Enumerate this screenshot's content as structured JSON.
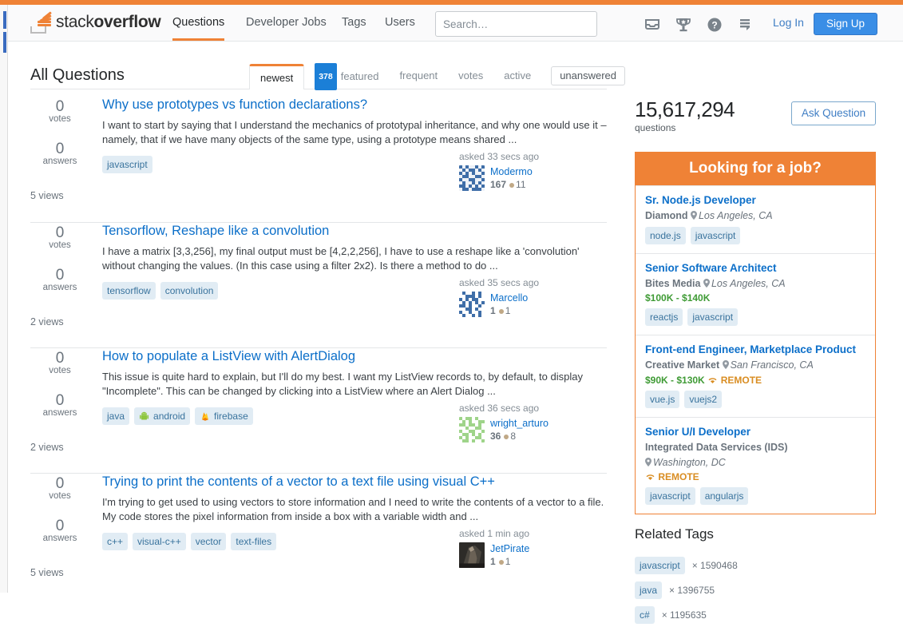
{
  "header": {
    "logo_text_light": "stack",
    "logo_text_bold": "overflow",
    "nav": [
      {
        "label": "Questions",
        "name": "nav-questions",
        "active": true
      },
      {
        "label": "Developer Jobs",
        "name": "nav-devjobs",
        "active": false
      },
      {
        "label": "Tags",
        "name": "nav-tags",
        "active": false
      },
      {
        "label": "Users",
        "name": "nav-users",
        "active": false
      }
    ],
    "search_placeholder": "Search…",
    "search_value": "",
    "icons": [
      "inbox-icon",
      "trophy-icon",
      "help-icon",
      "review-icon"
    ],
    "login_label": "Log In",
    "signup_label": "Sign Up"
  },
  "main": {
    "page_title": "All Questions",
    "tabs": [
      {
        "label": "newest",
        "active": true
      },
      {
        "label": "featured",
        "badge": "378",
        "active": false
      },
      {
        "label": "frequent",
        "active": false
      },
      {
        "label": "votes",
        "active": false
      },
      {
        "label": "active",
        "active": false
      }
    ],
    "unanswered_label": "unanswered",
    "question_count": "15,617,294",
    "question_count_label": "questions",
    "ask_button": "Ask Question"
  },
  "questions": [
    {
      "votes": "0",
      "votes_label": "votes",
      "answers": "0",
      "answers_label": "answers",
      "views": "5 views",
      "title": "Why use prototypes vs function declarations?",
      "excerpt": "I want to start by saying that I understand the mechanics of prototypal inheritance, and why one would use it – namely, that if we have many objects of the same type, using a prototype means shared ...",
      "tags": [
        {
          "label": "javascript",
          "icon": null
        }
      ],
      "asked": "asked 33 secs ago",
      "user": "Modermo",
      "reputation": "167",
      "badge_count": "11",
      "avatar": "identicon-blue"
    },
    {
      "votes": "0",
      "votes_label": "votes",
      "answers": "0",
      "answers_label": "answers",
      "views": "2 views",
      "title": "Tensorflow, Reshape like a convolution",
      "excerpt": "I have a matrix [3,3,256], my final output must be [4,2,2,256], I have to use a reshape like a 'convolution' without changing the values. (In this case using a filter 2x2). Is there a method to do ...",
      "tags": [
        {
          "label": "tensorflow",
          "icon": null
        },
        {
          "label": "convolution",
          "icon": null
        }
      ],
      "asked": "asked 35 secs ago",
      "user": "Marcello",
      "reputation": "1",
      "badge_count": "1",
      "avatar": "identicon-blue-dots"
    },
    {
      "votes": "0",
      "votes_label": "votes",
      "answers": "0",
      "answers_label": "answers",
      "views": "2 views",
      "title": "How to populate a ListView with AlertDialog",
      "excerpt": "This issue is quite hard to explain, but I'll do my best. I want my ListView records to, by default, to display \"Incomplete\". This can be changed by clicking into a ListView where an Alert Dialog ...",
      "tags": [
        {
          "label": "java",
          "icon": null
        },
        {
          "label": "android",
          "icon": "android-icon"
        },
        {
          "label": "firebase",
          "icon": "firebase-icon"
        }
      ],
      "asked": "asked 36 secs ago",
      "user": "wright_arturo",
      "reputation": "36",
      "badge_count": "8",
      "avatar": "identicon-green"
    },
    {
      "votes": "0",
      "votes_label": "votes",
      "answers": "0",
      "answers_label": "answers",
      "views": "5 views",
      "title": "Trying to print the contents of a vector to a text file using visual C++",
      "excerpt": "I'm trying to get used to using vectors to store information and I need to write the contents of a vector to a file. My code stores the pixel information from inside a box with a variable width and ...",
      "tags": [
        {
          "label": "c++",
          "icon": null
        },
        {
          "label": "visual-c++",
          "icon": null
        },
        {
          "label": "vector",
          "icon": null
        },
        {
          "label": "text-files",
          "icon": null
        }
      ],
      "asked": "asked 1 min ago",
      "user": "JetPirate",
      "reputation": "1",
      "badge_count": "1",
      "avatar": "photo-dark"
    }
  ],
  "jobs_card": {
    "header": "Looking for a job?",
    "jobs": [
      {
        "title": "Sr. Node.js Developer",
        "company": "Diamond",
        "location": "Los Angeles, CA",
        "salary": "",
        "remote": "",
        "tags": [
          "node.js",
          "javascript"
        ]
      },
      {
        "title": "Senior Software Architect",
        "company": "Bites Media",
        "location": "Los Angeles, CA",
        "salary": "$100K - $140K",
        "remote": "",
        "tags": [
          "reactjs",
          "javascript"
        ]
      },
      {
        "title": "Front-end Engineer, Marketplace Product",
        "company": "Creative Market",
        "location": "San Francisco, CA",
        "salary": "$90K - $130K",
        "remote": "REMOTE",
        "tags": [
          "vue.js",
          "vuejs2"
        ]
      },
      {
        "title": "Senior U/I Developer",
        "company": "Integrated Data Services (IDS)",
        "location": "Washington, DC",
        "salary": "",
        "remote": "REMOTE",
        "tags": [
          "javascript",
          "angularjs"
        ]
      }
    ]
  },
  "related_tags": {
    "title": "Related Tags",
    "items": [
      {
        "tag": "javascript",
        "count": "× 1590468"
      },
      {
        "tag": "java",
        "count": "× 1396755"
      },
      {
        "tag": "c#",
        "count": "× 1195635"
      }
    ]
  },
  "colors": {
    "orange": "#ef8236",
    "link_blue": "#0c6fc9",
    "tag_bg": "#e1ecf4",
    "tag_fg": "#39739d",
    "salary_green": "#3f9b35",
    "remote_gold": "#d98d22",
    "signup_blue": "#3a8ee6",
    "badge_blue": "#1b7fd7"
  }
}
